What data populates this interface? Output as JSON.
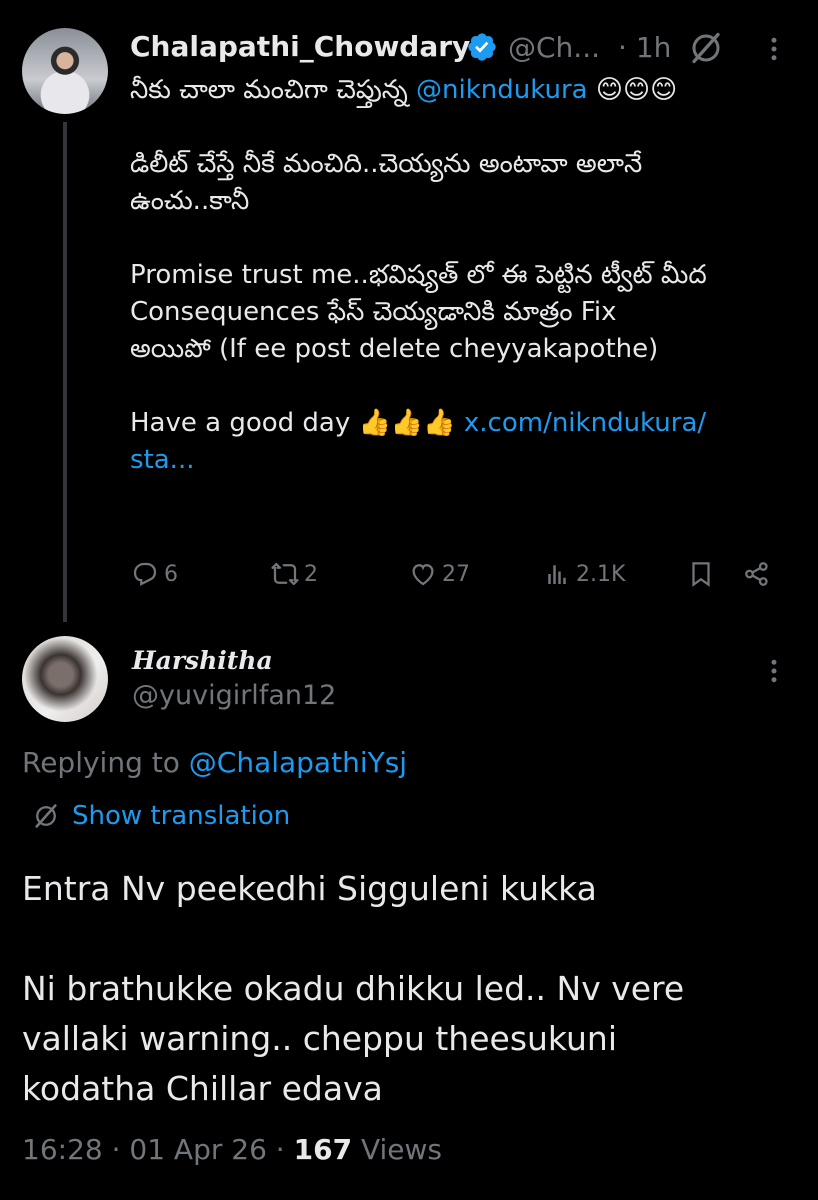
{
  "parent_tweet": {
    "author_name": "Chalapathi_Chowdary",
    "handle": "@Ch...",
    "separator": "·",
    "time": "1h",
    "lines": [
      "నీకు చాలా మంచిగా చెప్తున్న ",
      "డిలీట్ చేస్తే నీకే మంచిది..చెయ్యను అంటావా అలానే",
      "ఉంచు..కానీ",
      "Promise trust me..భవిష్యత్ లో ఈ పెట్టిన ట్వీట్ మీద",
      "Consequences  ఫేస్ చెయ్యడానికి మాత్రం Fix",
      "అయిపో (If ee post delete cheyyakapothe)",
      "Have a good day 👍👍👍 "
    ],
    "mention": "@nikndukura",
    "emoji_smiles": "😊😊😊",
    "link": "x.com/nikndukura/",
    "link_cont": "sta...",
    "stats": {
      "replies": "6",
      "reposts": "2",
      "likes": "27",
      "views": "2.1K"
    }
  },
  "reply": {
    "author_name": "Harshitha",
    "handle": "@yuvigirlfan12",
    "replying_prefix": "Replying to ",
    "replying_to": "@ChalapathiYsj",
    "show_translation": "Show translation",
    "lines": [
      "Entra Nv peekedhi Sigguleni kukka",
      "Ni brathukke okadu dhikku led.. Nv vere",
      "vallaki warning.. cheppu theesukuni",
      "kodatha Chillar edava"
    ],
    "time": "16:28",
    "dot": " · ",
    "date": "01 Apr 26",
    "views_count": "167",
    "views_label": " Views"
  },
  "colors": {
    "background": "#000000",
    "text": "#e7e9ea",
    "muted": "#71767b",
    "accent": "#1d9bf0"
  },
  "icons": [
    "verified-badge-icon",
    "grok-icon",
    "more-icon",
    "reply-icon",
    "repost-icon",
    "like-icon",
    "views-icon",
    "bookmark-icon",
    "share-icon",
    "translate-icon"
  ]
}
